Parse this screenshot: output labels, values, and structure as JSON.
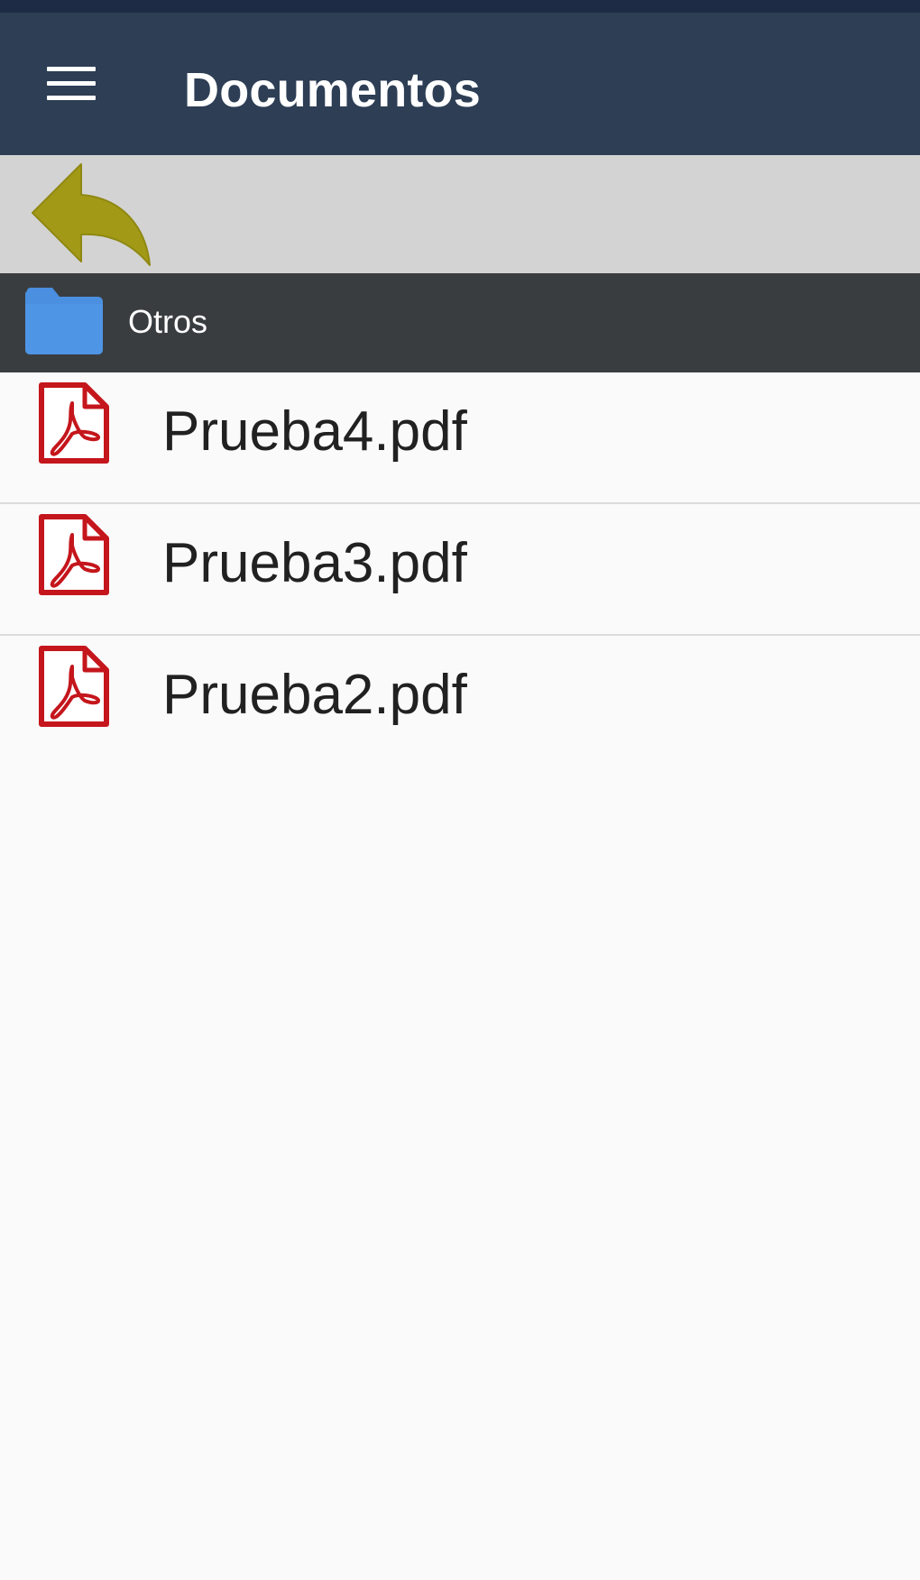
{
  "app_bar": {
    "title": "Documentos",
    "menu_icon": "hamburger-menu-icon",
    "background": "#2d3e55"
  },
  "toolbar": {
    "back_icon": "reply-back-arrow-icon",
    "back_color": "#a29a16",
    "background": "#d3d3d3"
  },
  "folder": {
    "name": "Otros",
    "icon": "folder-icon",
    "icon_color": "#4a8fe0",
    "background": "#3a3d40"
  },
  "files": [
    {
      "name": "Prueba4.pdf",
      "icon": "pdf-file-icon"
    },
    {
      "name": "Prueba3.pdf",
      "icon": "pdf-file-icon"
    },
    {
      "name": "Prueba2.pdf",
      "icon": "pdf-file-icon"
    }
  ],
  "colors": {
    "pdf_icon": "#c4161c",
    "list_background": "#fafafa",
    "divider": "#dcdcdc"
  }
}
